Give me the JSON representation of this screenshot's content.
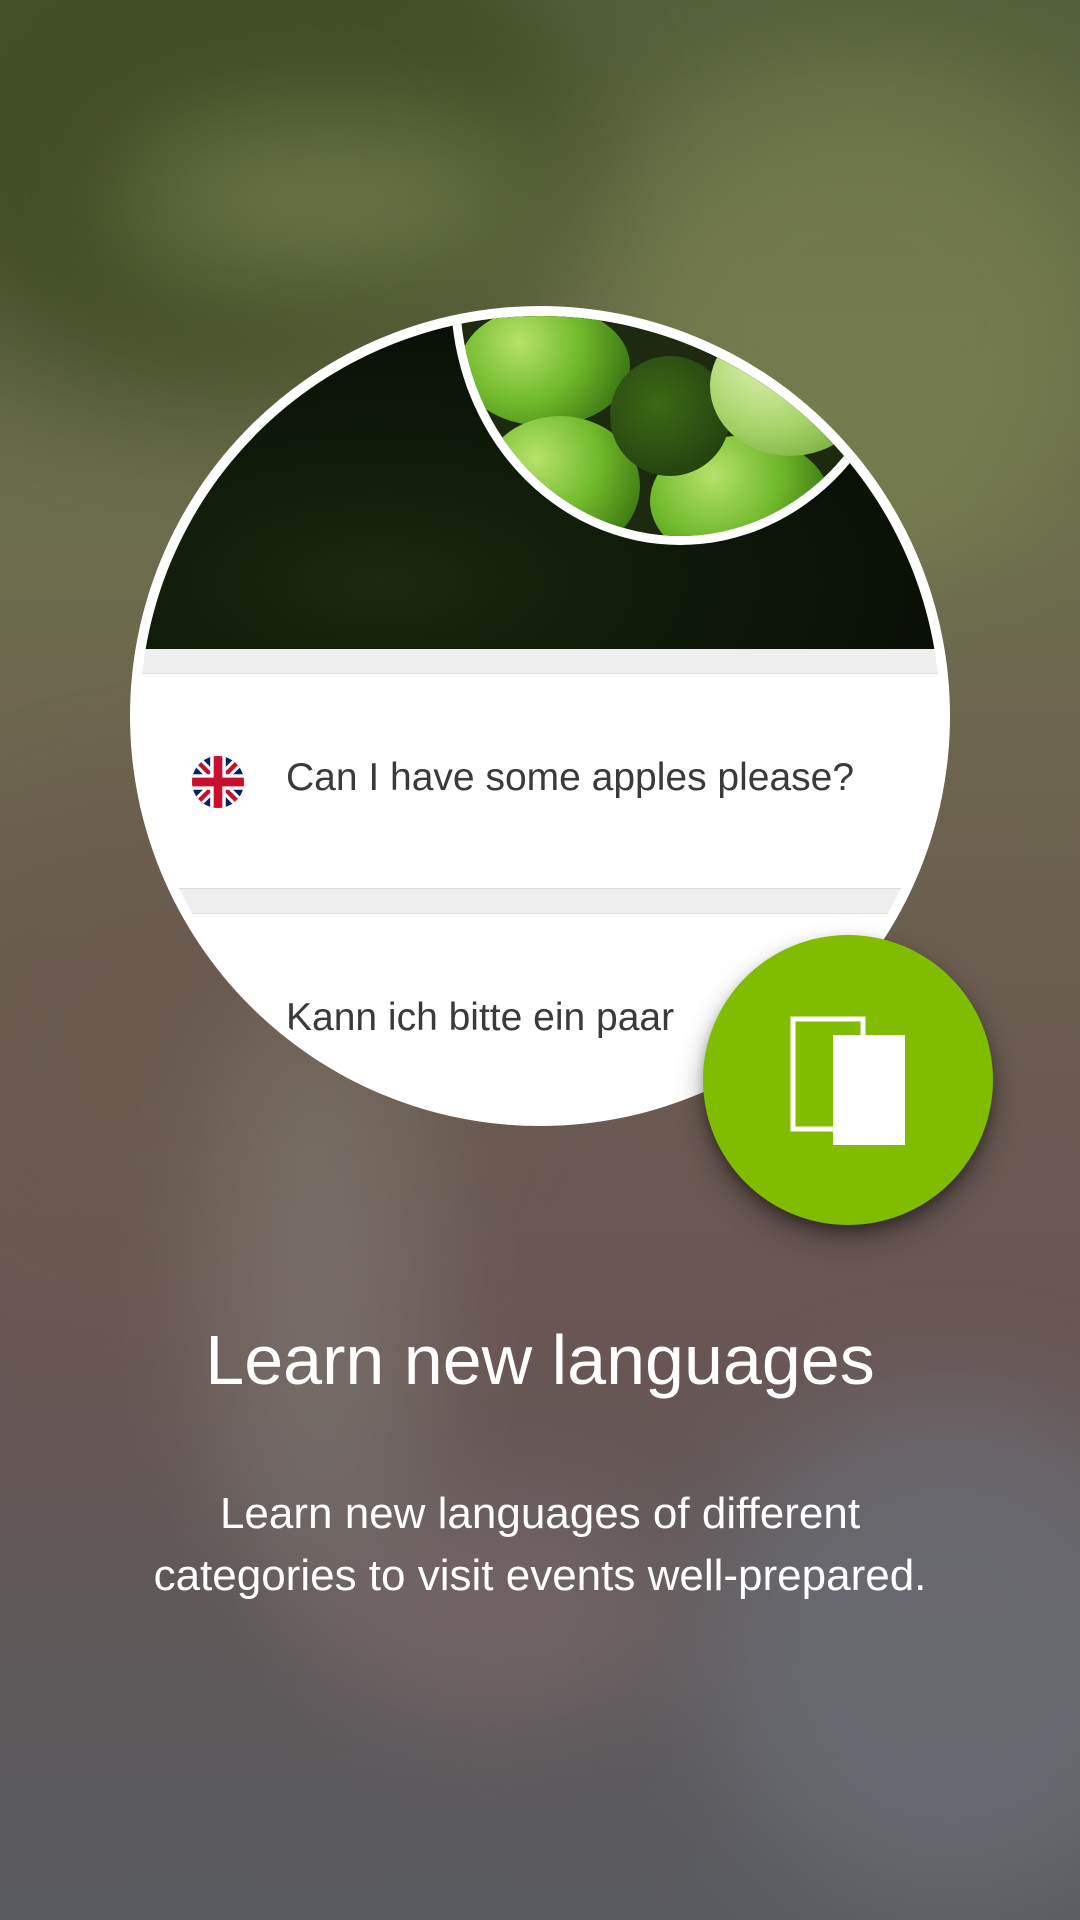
{
  "illustration": {
    "phrase_english": "Can I have some apples please?",
    "phrase_german": "Kann ich bitte ein paar",
    "flag": "united-kingdom-flag-icon"
  },
  "fab": {
    "icon": "cards-icon",
    "color": "#80bc00"
  },
  "onboarding": {
    "title": "Learn new languages",
    "description_line1": "Learn new languages of different",
    "description_line2": "categories to visit events well-prepared."
  }
}
